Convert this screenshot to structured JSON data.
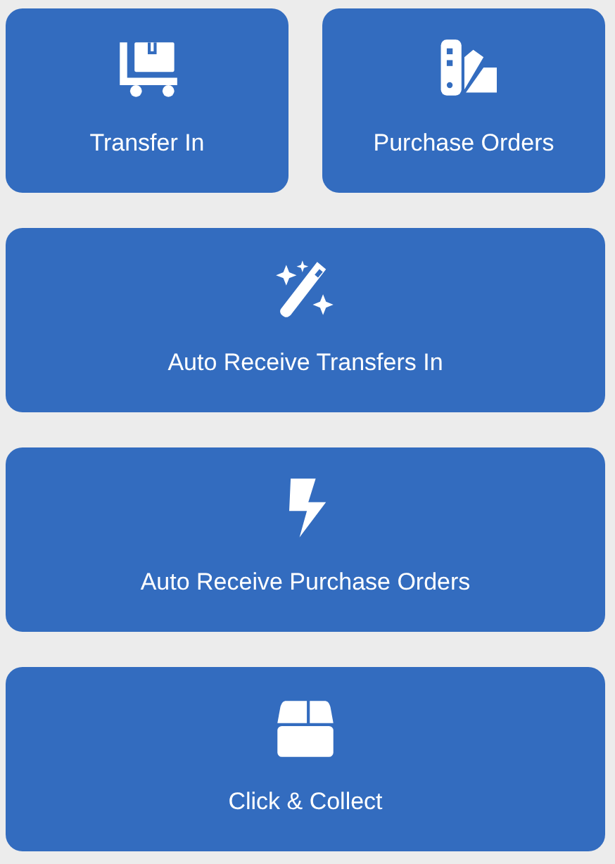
{
  "tiles": [
    {
      "label": "Transfer In",
      "kind": "half"
    },
    {
      "label": "Purchase Orders",
      "kind": "half"
    },
    {
      "label": "Auto Receive Transfers In",
      "kind": "full"
    },
    {
      "label": "Auto Receive Purchase Orders",
      "kind": "full"
    },
    {
      "label": "Click & Collect",
      "kind": "full"
    }
  ]
}
